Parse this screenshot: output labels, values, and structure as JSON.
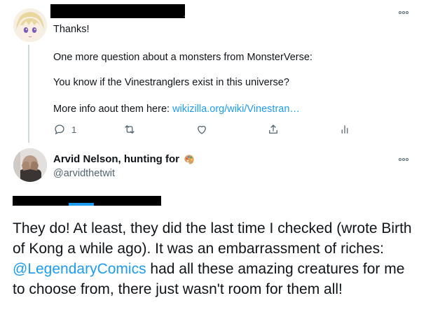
{
  "reply": {
    "author_suffix": ".",
    "lines": {
      "thanks": "Thanks!",
      "question": "One more question about a monsters from MonsterVerse:",
      "vinestranglers": "You know if the Vinestranglers exist in this universe?",
      "more_info": "More info aout them here: ",
      "link": "wikizilla.org/wiki/Vinestran…"
    },
    "actions": {
      "reply_count": "1"
    }
  },
  "tweet": {
    "author_name": "Arvid Nelson, hunting for",
    "author_emoji": "palette",
    "handle": "@arvidthetwit",
    "text_before": "They do! At least, they did the last time I checked (wrote Birth of Kong a while ago). It was an embarrassment of riches: ",
    "mention": "@LegendaryComics",
    "text_after": "  had all these amazing creatures for me to choose from, there just wasn't room for them all!"
  },
  "colors": {
    "link": "#1d9bf0",
    "text": "#0f1419",
    "muted": "#536471",
    "thread_line": "#cfd9de"
  },
  "icons": [
    "more-icon",
    "reply-icon",
    "retweet-icon",
    "like-icon",
    "share-icon",
    "analytics-icon",
    "palette-icon"
  ]
}
